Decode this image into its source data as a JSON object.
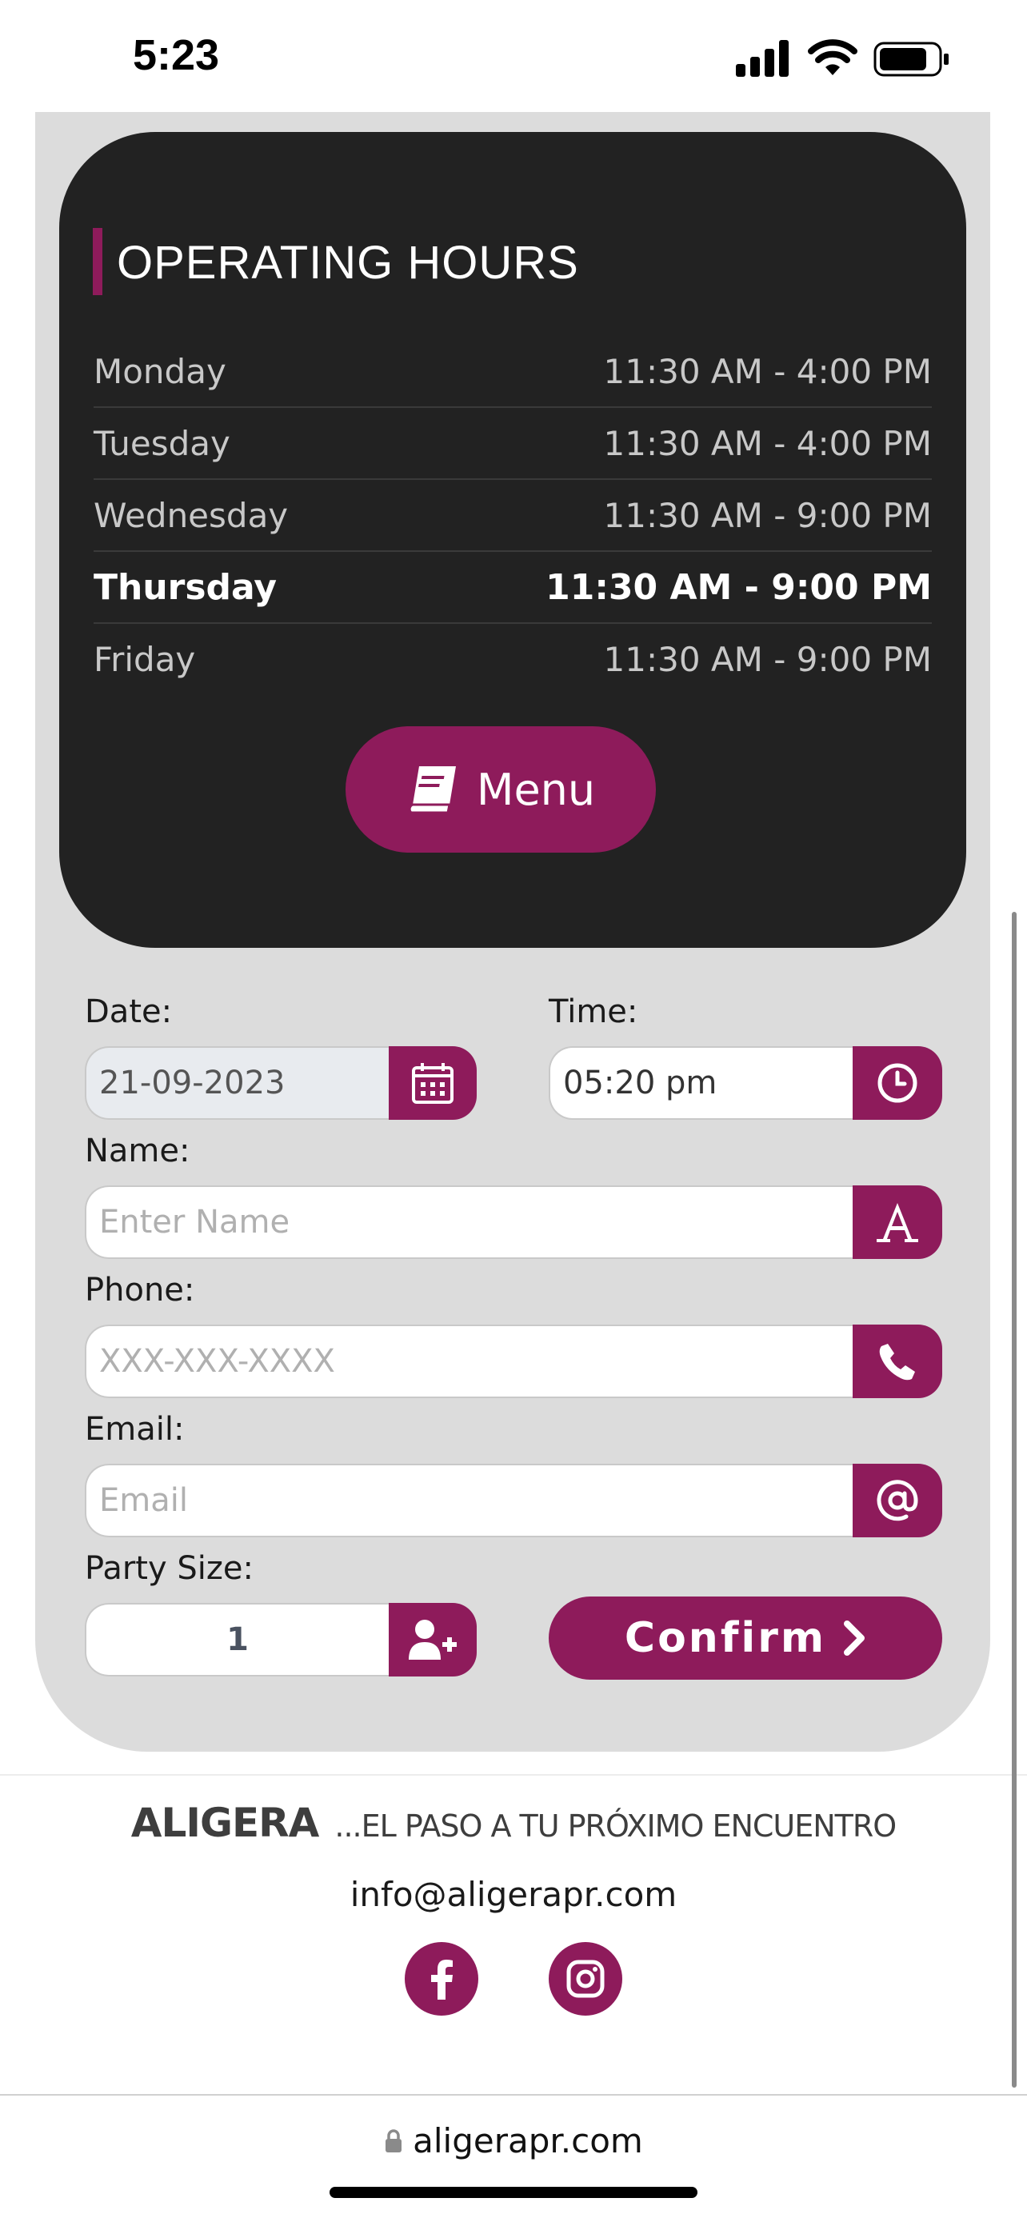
{
  "status_bar": {
    "time": "5:23"
  },
  "hours": {
    "title": "OPERATING HOURS",
    "rows": [
      {
        "day": "Monday",
        "time": "11:30 AM - 4:00 PM"
      },
      {
        "day": "Tuesday",
        "time": "11:30 AM - 4:00 PM"
      },
      {
        "day": "Wednesday",
        "time": "11:30 AM - 9:00 PM"
      },
      {
        "day": "Thursday",
        "time": "11:30 AM - 9:00 PM",
        "highlighted": true
      },
      {
        "day": "Friday",
        "time": "11:30 AM - 9:00 PM"
      }
    ],
    "menu_button": "Menu"
  },
  "form": {
    "date": {
      "label": "Date:",
      "value": "21-09-2023"
    },
    "time": {
      "label": "Time:",
      "value": "05:20 pm"
    },
    "name": {
      "label": "Name:",
      "placeholder": "Enter Name"
    },
    "phone": {
      "label": "Phone:",
      "placeholder": "XXX-XXX-XXXX"
    },
    "email": {
      "label": "Email:",
      "placeholder": "Email"
    },
    "party": {
      "label": "Party Size:",
      "value": "1"
    },
    "confirm": "Confirm"
  },
  "footer": {
    "brand": "ALIGERA",
    "tagline": "...EL PASO A TU PRÓXIMO ENCUENTRO",
    "email": "info@aligerapr.com"
  },
  "browser": {
    "url": "aligerapr.com"
  },
  "colors": {
    "accent": "#8e1b5b",
    "card": "#222222",
    "page_bg": "#dcdcdc"
  }
}
